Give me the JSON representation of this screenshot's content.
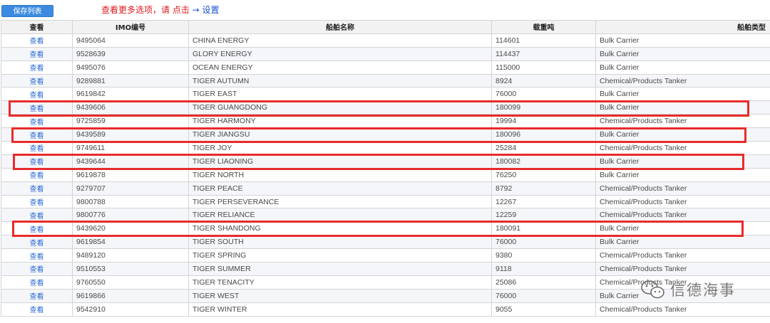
{
  "toolbar": {
    "save_label": "保存列表",
    "tip_text": "查看更多选项，请 点击",
    "tip_arrow": "→",
    "tip_link": "设置"
  },
  "table": {
    "headers": [
      "查看",
      "IMO编号",
      "船舶名称",
      "载重吨",
      "船舶类型"
    ],
    "rows": [
      {
        "view": "查看",
        "imo": "9495064",
        "name": "CHINA ENERGY",
        "dwt": "114601",
        "type": "Bulk Carrier"
      },
      {
        "view": "查看",
        "imo": "9528639",
        "name": "GLORY ENERGY",
        "dwt": "114437",
        "type": "Bulk Carrier"
      },
      {
        "view": "查看",
        "imo": "9495076",
        "name": "OCEAN ENERGY",
        "dwt": "115000",
        "type": "Bulk Carrier"
      },
      {
        "view": "查看",
        "imo": "9289881",
        "name": "TIGER AUTUMN",
        "dwt": "8924",
        "type": "Chemical/Products Tanker"
      },
      {
        "view": "查看",
        "imo": "9619842",
        "name": "TIGER EAST",
        "dwt": "76000",
        "type": "Bulk Carrier"
      },
      {
        "view": "查看",
        "imo": "9439606",
        "name": "TIGER GUANGDONG",
        "dwt": "180099",
        "type": "Bulk Carrier"
      },
      {
        "view": "查看",
        "imo": "9725859",
        "name": "TIGER HARMONY",
        "dwt": "19994",
        "type": "Chemical/Products Tanker"
      },
      {
        "view": "查看",
        "imo": "9439589",
        "name": "TIGER JIANGSU",
        "dwt": "180096",
        "type": "Bulk Carrier"
      },
      {
        "view": "查看",
        "imo": "9749611",
        "name": "TIGER JOY",
        "dwt": "25284",
        "type": "Chemical/Products Tanker"
      },
      {
        "view": "查看",
        "imo": "9439644",
        "name": "TIGER LIAONING",
        "dwt": "180082",
        "type": "Bulk Carrier"
      },
      {
        "view": "查看",
        "imo": "9619878",
        "name": "TIGER NORTH",
        "dwt": "76250",
        "type": "Bulk Carrier"
      },
      {
        "view": "查看",
        "imo": "9279707",
        "name": "TIGER PEACE",
        "dwt": "8792",
        "type": "Chemical/Products Tanker"
      },
      {
        "view": "查看",
        "imo": "9800788",
        "name": "TIGER PERSEVERANCE",
        "dwt": "12267",
        "type": "Chemical/Products Tanker"
      },
      {
        "view": "查看",
        "imo": "9800776",
        "name": "TIGER RELIANCE",
        "dwt": "12259",
        "type": "Chemical/Products Tanker"
      },
      {
        "view": "查看",
        "imo": "9439620",
        "name": "TIGER SHANDONG",
        "dwt": "180091",
        "type": "Bulk Carrier"
      },
      {
        "view": "查看",
        "imo": "9619854",
        "name": "TIGER SOUTH",
        "dwt": "76000",
        "type": "Bulk Carrier"
      },
      {
        "view": "查看",
        "imo": "9489120",
        "name": "TIGER SPRING",
        "dwt": "9380",
        "type": "Chemical/Products Tanker"
      },
      {
        "view": "查看",
        "imo": "9510553",
        "name": "TIGER SUMMER",
        "dwt": "9118",
        "type": "Chemical/Products Tanker"
      },
      {
        "view": "查看",
        "imo": "9760550",
        "name": "TIGER TENACITY",
        "dwt": "25086",
        "type": "Chemical/Products Tanker"
      },
      {
        "view": "查看",
        "imo": "9619866",
        "name": "TIGER WEST",
        "dwt": "76000",
        "type": "Bulk Carrier"
      },
      {
        "view": "查看",
        "imo": "9542910",
        "name": "TIGER WINTER",
        "dwt": "9055",
        "type": "Chemical/Products Tanker"
      }
    ]
  },
  "highlighted_rows": [
    "TIGER GUANGDONG",
    "TIGER JIANGSU",
    "TIGER LIAONING",
    "TIGER SHANDONG"
  ],
  "watermark": {
    "text": "信德海事",
    "icon": "wechat-icon"
  },
  "colors": {
    "accent": "#3d8be0",
    "tip": "#e0191e",
    "link": "#2b6ad8",
    "highlight": "#e82b2b"
  }
}
